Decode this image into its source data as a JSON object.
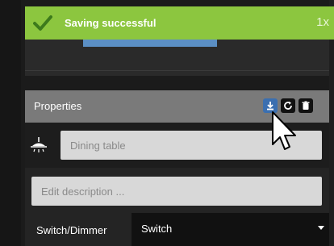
{
  "colors": {
    "toast_bg": "#8cc63f",
    "panel_header_bg": "#7a7a7a",
    "accent_blue": "#5b8fc4",
    "input_bg": "#d8d8d8"
  },
  "toast": {
    "message": "Saving successful",
    "count": "1x",
    "icon": "check-icon"
  },
  "panel": {
    "title": "Properties",
    "actions": [
      {
        "name": "download",
        "icon": "download-icon"
      },
      {
        "name": "refresh",
        "icon": "refresh-icon"
      },
      {
        "name": "delete",
        "icon": "trash-icon"
      }
    ],
    "name_field": {
      "placeholder": "Dining table",
      "value": "",
      "icon": "ceiling-lamp-icon"
    },
    "description_field": {
      "placeholder": "Edit description ...",
      "value": ""
    },
    "type_field": {
      "label": "Switch/Dimmer",
      "selected": "Switch"
    }
  }
}
